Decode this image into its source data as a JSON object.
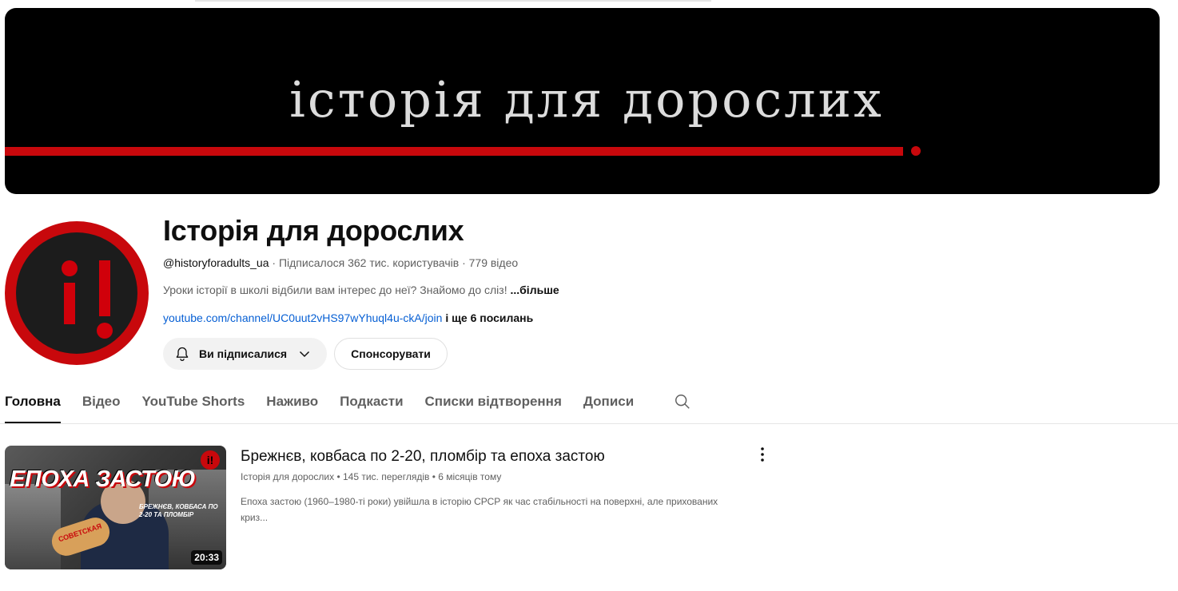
{
  "banner": {
    "title": "історія для дорослих"
  },
  "channel": {
    "name": "Історія для дорослих",
    "handle": "@historyforadults_ua",
    "subscribers": " · Підписалося 362 тис. користувачів · 779 відео",
    "description": "Уроки історії в школі відбили вам інтерес до неї? Знайомо до сліз! ",
    "more": "...більше",
    "link": "youtube.com/channel/UC0uut2vHS97wYhuql4u-ckA/join",
    "links_extra": " і ще 6 посилань"
  },
  "buttons": {
    "subscribed_label": "Ви підписалися",
    "sponsor_label": "Спонсорувати"
  },
  "tabs": [
    {
      "label": "Головна",
      "active": true
    },
    {
      "label": "Відео"
    },
    {
      "label": "YouTube Shorts"
    },
    {
      "label": "Наживо"
    },
    {
      "label": "Подкасти"
    },
    {
      "label": "Списки відтворення"
    },
    {
      "label": "Дописи"
    }
  ],
  "video": {
    "thumb_title": "ЕПОХА ЗАСТОЮ",
    "thumb_subtitle": "БРЕЖНЄВ, КОВБАСА ПО 2-20 ТА ПЛОМБІР",
    "thumb_label": "СОВЕТСКАЯ",
    "thumb_logo": "i!",
    "duration": "20:33",
    "title": "Брежнєв, ковбаса по 2-20, пломбір та епоха застою",
    "meta": "Історія для дорослих • 145 тис. переглядів • 6 місяців тому",
    "description": "Епоха застою (1960–1980-ті роки) увійшла в історію СРСР як час стабільності на поверхні, але прихованих криз..."
  },
  "icons": {
    "bell": "bell-icon",
    "chevron": "chevron-down-icon",
    "search": "search-icon",
    "menu": "more-vertical-icon"
  },
  "colors": {
    "accent_red": "#c8080c",
    "link_blue": "#065fd4"
  }
}
